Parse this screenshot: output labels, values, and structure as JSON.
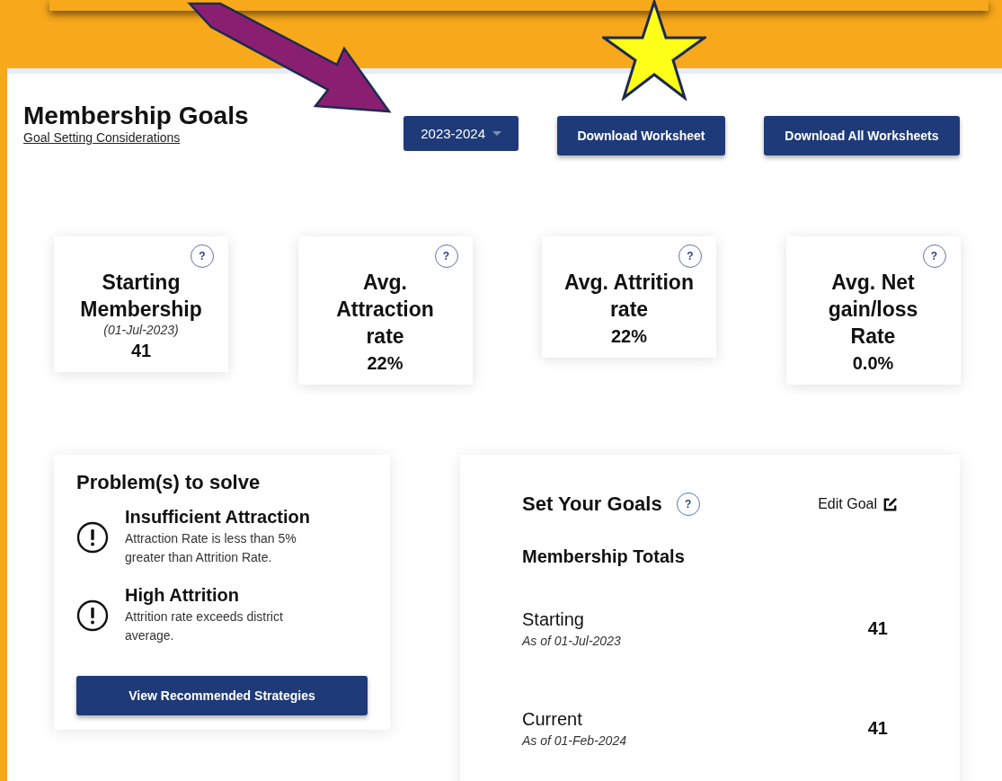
{
  "header": {
    "title": "Membership Goals",
    "link": "Goal Setting Considerations",
    "year_select": "2023-2024",
    "buttons": [
      "Download Worksheet",
      "Download All Worksheets"
    ]
  },
  "stats": [
    {
      "help": "?",
      "label": "Starting Membership",
      "date": "(01-Jul-2023)",
      "value": "41"
    },
    {
      "help": "?",
      "label": "Avg. Attraction rate",
      "value": "22%"
    },
    {
      "help": "?",
      "label": "Avg. Attrition rate",
      "value": "22%"
    },
    {
      "help": "?",
      "label": "Avg. Net gain/loss Rate",
      "value": "0.0%"
    }
  ],
  "problems": {
    "title": "Problem(s) to solve",
    "items": [
      {
        "title": "Insufficient Attraction",
        "text": "Attraction Rate is less than 5% greater than Attrition Rate."
      },
      {
        "title": "High Attrition",
        "text": "Attrition rate exceeds district average."
      }
    ],
    "button": "View Recommended Strategies"
  },
  "goals": {
    "title": "Set Your Goals",
    "help": "?",
    "edit": "Edit Goal",
    "section": "Membership Totals",
    "rows": [
      {
        "label": "Starting",
        "date": "As of 01-Jul-2023",
        "value": "41"
      },
      {
        "label": "Current",
        "date": "As of 01-Feb-2024",
        "value": "41"
      }
    ]
  }
}
